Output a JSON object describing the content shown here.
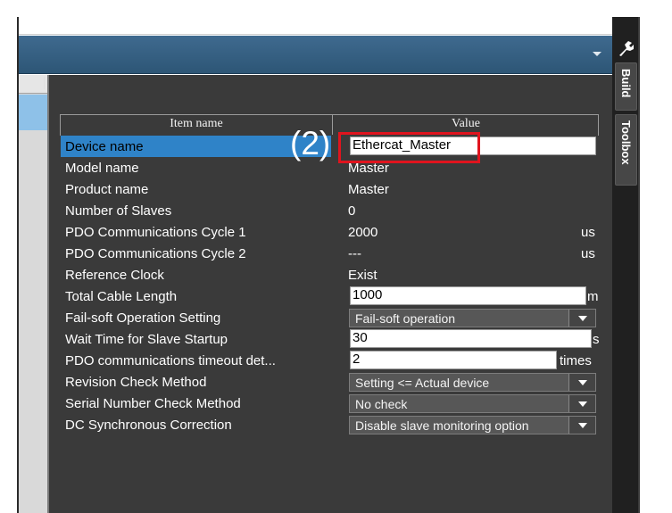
{
  "side_tabs": {
    "build_label": "Build",
    "toolbox_label": "Toolbox",
    "tool_icon": "wrench-icon"
  },
  "grid": {
    "header": {
      "item_name": "Item name",
      "value": "Value"
    },
    "rows": [
      {
        "name": "Device name",
        "value": "Ethercat_Master",
        "unit": "",
        "kind": "text",
        "selected": true
      },
      {
        "name": "Model name",
        "value": "Master",
        "unit": "",
        "kind": "static"
      },
      {
        "name": "Product name",
        "value": "Master",
        "unit": "",
        "kind": "static"
      },
      {
        "name": "Number of Slaves",
        "value": "0",
        "unit": "",
        "kind": "static"
      },
      {
        "name": "PDO Communications Cycle 1",
        "value": "2000",
        "unit": "us",
        "kind": "static"
      },
      {
        "name": "PDO Communications Cycle 2",
        "value": "---",
        "unit": "us",
        "kind": "static"
      },
      {
        "name": "Reference Clock",
        "value": "Exist",
        "unit": "",
        "kind": "static"
      },
      {
        "name": "Total Cable Length",
        "value": "1000",
        "unit": "m",
        "kind": "text"
      },
      {
        "name": "Fail-soft Operation Setting",
        "value": "Fail-soft operation",
        "unit": "",
        "kind": "combo"
      },
      {
        "name": "Wait Time for Slave Startup",
        "value": "30",
        "unit": "s",
        "kind": "text"
      },
      {
        "name": "PDO communications timeout det...",
        "value": "2",
        "unit": "times",
        "kind": "text"
      },
      {
        "name": "Revision Check Method",
        "value": "Setting <= Actual device",
        "unit": "",
        "kind": "combo"
      },
      {
        "name": "Serial Number Check Method",
        "value": "No check",
        "unit": "",
        "kind": "combo"
      },
      {
        "name": "DC Synchronous Correction",
        "value": "Disable slave monitoring option",
        "unit": "",
        "kind": "combo"
      }
    ]
  },
  "annotation": {
    "label": "(2)",
    "color": "#e0141e"
  },
  "colors": {
    "panel_bg": "#3a3a3a",
    "selection": "#2f83c8",
    "topbar": "#2d5676"
  }
}
